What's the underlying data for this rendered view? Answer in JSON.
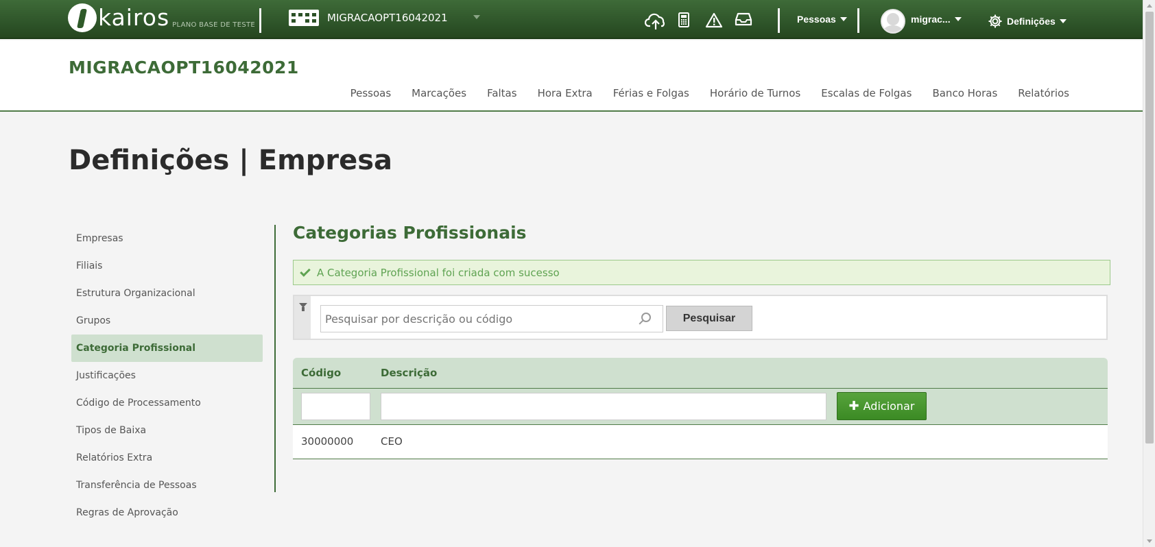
{
  "topbar": {
    "logo_text": "kairos",
    "logo_subtext": "PLANO BASE DE TESTE",
    "company_name": "MIGRACAOPT16042021",
    "icons": [
      "cloud-upload-icon",
      "calculator-icon",
      "warning-icon",
      "inbox-icon"
    ],
    "people_menu": "Pessoas",
    "user_name": "migrac...",
    "settings_menu": "Definições"
  },
  "header": {
    "title": "MIGRACAOPT16042021",
    "nav": [
      "Pessoas",
      "Marcações",
      "Faltas",
      "Hora Extra",
      "Férias e Folgas",
      "Horário de Turnos",
      "Escalas de Folgas",
      "Banco Horas",
      "Relatórios"
    ]
  },
  "page_title": "Definições | Empresa",
  "sidebar": {
    "items": [
      {
        "label": "Empresas"
      },
      {
        "label": "Filiais"
      },
      {
        "label": "Estrutura Organizacional"
      },
      {
        "label": "Grupos"
      },
      {
        "label": "Categoria Profissional",
        "active": true
      },
      {
        "label": "Justificações"
      },
      {
        "label": "Código de Processamento"
      },
      {
        "label": "Tipos de Baixa"
      },
      {
        "label": "Relatórios Extra"
      },
      {
        "label": "Transferência de Pessoas"
      },
      {
        "label": "Regras de Aprovação"
      }
    ]
  },
  "content": {
    "title": "Categorias Profissionais",
    "alert": "A Categoria Profissional foi criada com sucesso",
    "search_placeholder": "Pesquisar por descrição ou código",
    "search_button": "Pesquisar",
    "table": {
      "headers": [
        "Código",
        "Descrição"
      ],
      "add_button": "Adicionar",
      "rows": [
        {
          "code": "30000000",
          "description": "CEO"
        }
      ]
    }
  },
  "colors": {
    "brand_green": "#3d6b37",
    "topbar_green": "#2c5127",
    "active_bg": "#cfe0cf",
    "success": "#5fa352",
    "add_button": "#4a9830"
  }
}
